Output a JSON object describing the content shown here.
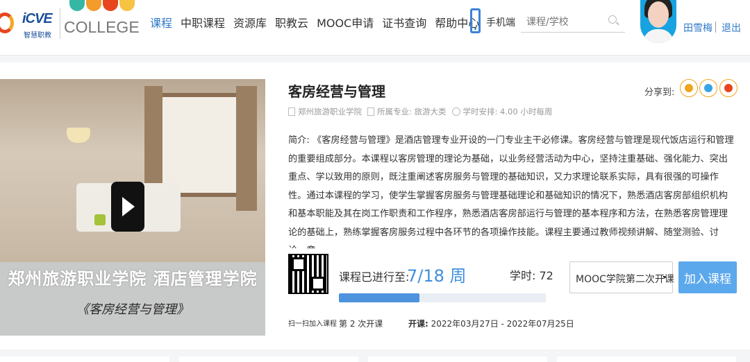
{
  "header": {
    "logo_icve": "iCVE",
    "logo_icve_sub": "智慧职教",
    "logo_mooc": "MOOC",
    "logo_college": "COLLEGE",
    "nav": [
      {
        "label": "课程",
        "active": true
      },
      {
        "label": "中职课程",
        "active": false
      },
      {
        "label": "资源库",
        "active": false
      },
      {
        "label": "职教云",
        "active": false
      },
      {
        "label": "MOOC申请",
        "active": false
      },
      {
        "label": "证书查询",
        "active": false
      },
      {
        "label": "帮助中心",
        "active": false
      }
    ],
    "mobile_label": "手机端",
    "search_placeholder": "课程/学校",
    "username": "田雪梅",
    "logout": "退出"
  },
  "course": {
    "title": "客房经营与管理",
    "share_label": "分享到:",
    "share_icons": [
      "qzone-icon",
      "qq-icon",
      "weibo-icon"
    ],
    "school": "郑州旅游职业学院",
    "major": "所属专业: 旅游大类",
    "schedule": "学时安排: 4.00 小时每周",
    "description": "简介: 《客房经营与管理》是酒店管理专业开设的一门专业主干必修课。客房经营与管理是现代饭店运行和管理的重要组成部分。本课程以客房管理的理论为基础，以业务经营活动为中心，坚持注重基础、强化能力、突出重点、学以致用的原则，既注重阐述客房服务与管理的基础知识，又力求理论联系实际，具有很强的可操作性。通过本课程的学习，使学生掌握客房服务与管理基础理论和基础知识的情况下，熟悉酒店客房部组织机构和基本职能及其在岗工作职责和工作程序，熟悉酒店客房部运行与管理的基本程序和方法，在熟悉客房管理理论的基础上，熟练掌握客房服务过程中各环节的各项操作技能。课程主要通过教师视频讲解、随堂测验、讨论、章",
    "video_banner_title": "郑州旅游职业学院 酒店管理学院",
    "video_banner_sub": "《客房经营与管理》",
    "qr_caption": "扫一扫加入课程",
    "progress_label": "课程已进行至:",
    "progress_value": "7/18 周",
    "progress_fraction": 0.389,
    "hours": "学时: 72",
    "open_count": "第 2 次开课",
    "open_date_label": "开课:",
    "open_date_value": "2022年03月27日 - 2022年07月25日",
    "session_select": "MOOC学院第二次开课",
    "join_button": "加入课程"
  },
  "colors": {
    "accent": "#2f79c7",
    "progress": "#4d93dd",
    "join": "#5ba8ec",
    "mooc_colors": [
      "#36b7a6",
      "#f39b2b",
      "#e8451e",
      "#f6c343"
    ]
  }
}
